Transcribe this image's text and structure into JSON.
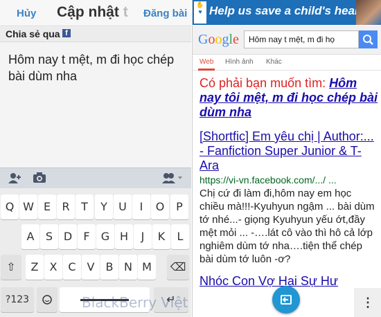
{
  "fb": {
    "cancel": "Hủy",
    "title": "Cập nhật",
    "title_fade": "t",
    "post": "Đăng bài",
    "share_label": "Chia sẻ qua",
    "fb_letter": "f",
    "compose_text": "Hôm nay t mệt, m đi học chép bài dùm nha"
  },
  "keyboard": {
    "row1": [
      "Q",
      "W",
      "E",
      "R",
      "T",
      "Y",
      "U",
      "I",
      "O",
      "P"
    ],
    "row2": [
      "A",
      "S",
      "D",
      "F",
      "G",
      "H",
      "J",
      "K",
      "L"
    ],
    "row3": [
      "Z",
      "X",
      "C",
      "V",
      "B",
      "N",
      "M"
    ],
    "shift": "⇧",
    "backspace": "⌫",
    "sym": "?123",
    "space_key": "▭",
    "enter": "↵"
  },
  "watermark": "BlackBerry Việt Nam",
  "browser": {
    "ad_text": "Help us save a child's heart!",
    "google_logo": "Google",
    "search_value": "Hôm nay t mệt, m đi họ",
    "tabs": [
      "Web",
      "Hình ảnh",
      "Khác"
    ],
    "did_you_mean_prefix": "Có phải bạn muốn tìm: ",
    "did_you_mean_link": "Hôm nay tôi mệt, m đi học chép bài dùm nha",
    "result_title": "[Shortfic] Em yêu chị | Author:... - Fanfiction Super Junior & T-Ara",
    "result_url": "https://vi-vn.facebook.com/.../ ...",
    "result_snippet": "Chị cứ đi làm đi,hôm nay em học chiều mà!!!-Kyuhyun ngậm ... bài dùm tớ nhé...- giọng Kyuhyun yếu ớt,đầy mệt mỏi ... -….lát cô vào thì hô cả lớp nghiêm dùm tớ nha….tiện thể chép bài dùm tớ luôn -ơ?",
    "next_title": "Nhóc Con Vợ Hai Sự Hư",
    "menu": "⋮"
  },
  "colors": {
    "link": "#1a0dab",
    "google_blue": "#4285f4",
    "google_red": "#ea4335",
    "google_yellow": "#fbbc05",
    "google_green": "#34a853",
    "fab": "#2196d3"
  }
}
